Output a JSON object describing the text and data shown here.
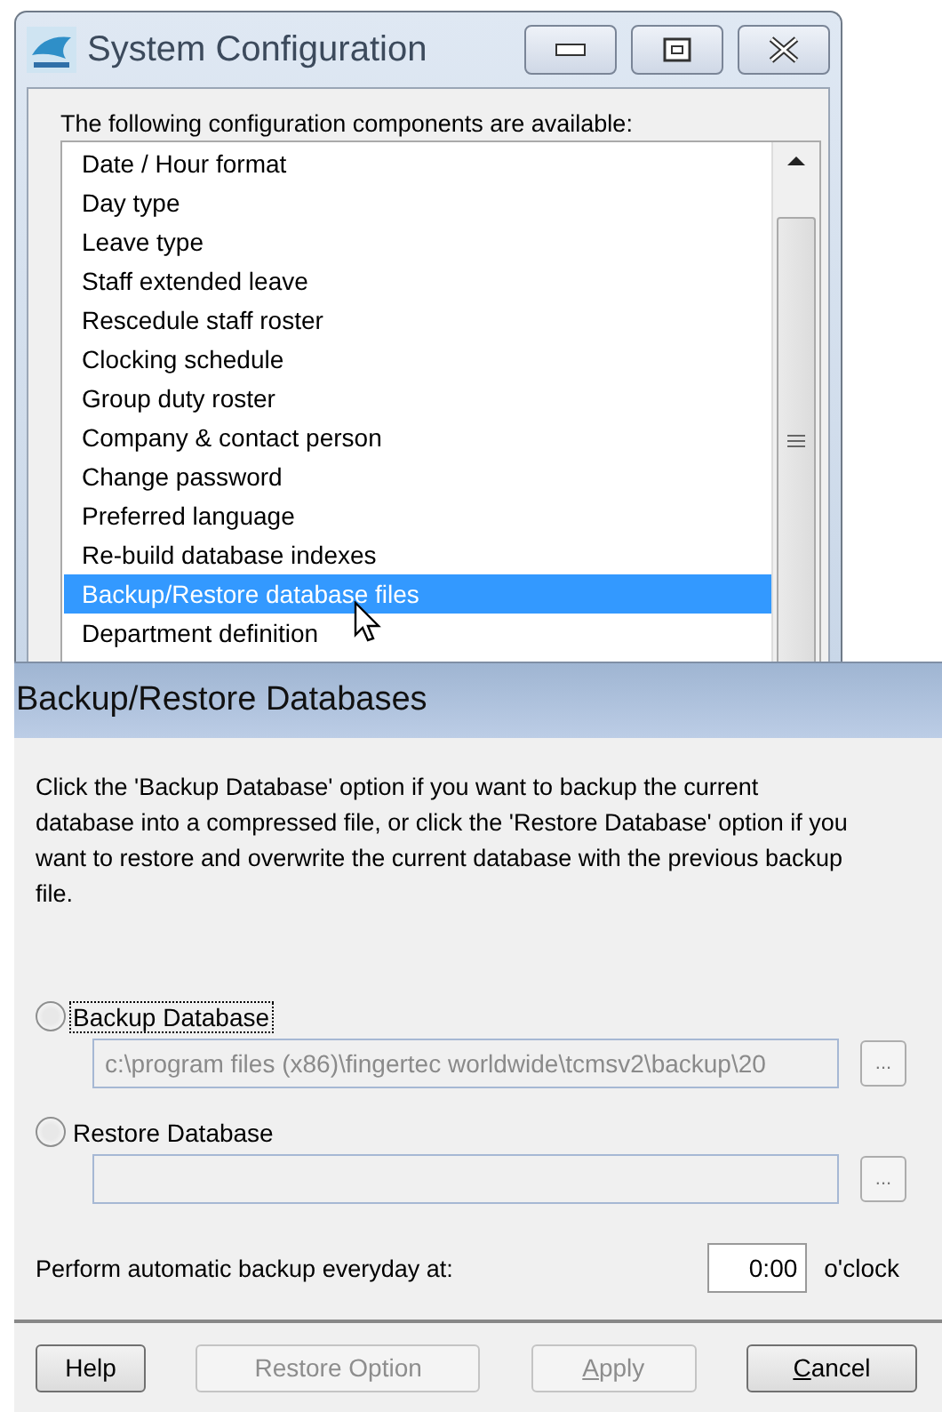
{
  "window": {
    "title": "System Configuration"
  },
  "components": {
    "label": "The following configuration components are available:",
    "items": [
      {
        "label": "Date / Hour format",
        "selected": false
      },
      {
        "label": "Day type",
        "selected": false
      },
      {
        "label": "Leave type",
        "selected": false
      },
      {
        "label": "Staff extended leave",
        "selected": false
      },
      {
        "label": "Rescedule staff roster",
        "selected": false
      },
      {
        "label": "Clocking schedule",
        "selected": false
      },
      {
        "label": "Group duty roster",
        "selected": false
      },
      {
        "label": "Company & contact person",
        "selected": false
      },
      {
        "label": "Change password",
        "selected": false
      },
      {
        "label": "Preferred language",
        "selected": false
      },
      {
        "label": "Re-build database indexes",
        "selected": false
      },
      {
        "label": "Backup/Restore database files",
        "selected": true
      },
      {
        "label": "Department definition",
        "selected": false
      }
    ]
  },
  "panel": {
    "title": "Backup/Restore Databases",
    "description": "Click the 'Backup Database' option if you want to backup the current database into a compressed file, or click the 'Restore Database' option if you want to restore and overwrite the current database with the previous backup file.",
    "options": [
      {
        "label": "Backup Database",
        "selected": false,
        "focused": true,
        "path": "c:\\program files (x86)\\fingertec worldwide\\tcmsv2\\backup\\20",
        "browse": "..."
      },
      {
        "label": "Restore Database",
        "selected": false,
        "focused": false,
        "browse": "..."
      }
    ],
    "schedule": {
      "label": "Perform automatic backup everyday at:",
      "value": "0:00",
      "unit": "o'clock"
    },
    "buttons": [
      {
        "label": "Help",
        "disabled": false,
        "underline_first": false
      },
      {
        "label": "Restore Option",
        "disabled": true,
        "underline_first": false
      },
      {
        "label": "Apply",
        "disabled": true,
        "underline_first": true
      },
      {
        "label": "Cancel",
        "disabled": false,
        "underline_first": true
      }
    ]
  }
}
